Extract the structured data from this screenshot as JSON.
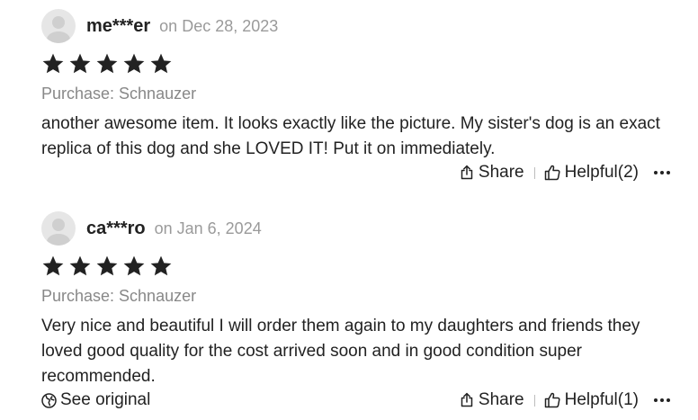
{
  "reviews": [
    {
      "username": "me***er",
      "date": "on Dec 28, 2023",
      "rating": 5,
      "purchase": "Purchase: Schnauzer",
      "text": "another awesome item. It looks exactly like the picture. My sister's dog is an exact replica of this dog and she LOVED IT! Put it on immediately.",
      "share_label": "Share",
      "helpful_label": "Helpful(2)"
    },
    {
      "username": "ca***ro",
      "date": "on Jan 6, 2024",
      "rating": 5,
      "purchase": "Purchase: Schnauzer",
      "text": "Very nice and beautiful I will order them again to my daughters and friends they loved good quality for the cost arrived soon and in good condition super recommended.",
      "see_original_label": "See original",
      "share_label": "Share",
      "helpful_label": "Helpful(1)"
    }
  ],
  "icons": {
    "avatar": "user-silhouette-icon",
    "star": "star-icon",
    "share": "share-icon",
    "helpful": "thumbs-up-icon",
    "more": "more-dots-icon",
    "see_original": "globe-icon"
  },
  "colors": {
    "text": "#222222",
    "muted": "#9a9a9a",
    "star": "#222222",
    "avatar_bg": "#e6e6e6"
  }
}
